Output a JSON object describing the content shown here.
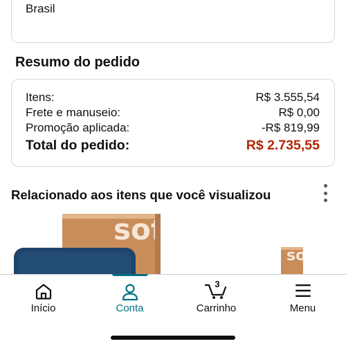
{
  "address": {
    "country": "Brasil"
  },
  "summary": {
    "heading": "Resumo do pedido",
    "rows": [
      {
        "label": "Itens:",
        "value": "R$ 3.555,54"
      },
      {
        "label": "Frete e manuseio:",
        "value": "R$ 0,00"
      },
      {
        "label": "Promoção aplicada:",
        "value": "-R$ 819,99"
      }
    ],
    "total": {
      "label": "Total do pedido:",
      "value": "R$ 2.735,55"
    }
  },
  "related": {
    "heading": "Relacionado aos itens que você visualizou",
    "more_icon": "kebab-menu-icon",
    "products": [
      {
        "brand_mark": "sofá",
        "icon": "product-box-image"
      },
      {
        "brand_mark": "sofá",
        "icon": "product-box-image"
      }
    ]
  },
  "nav": {
    "items": [
      {
        "label": "Início",
        "icon": "home-icon",
        "active": false
      },
      {
        "label": "Conta",
        "icon": "account-icon",
        "active": true
      },
      {
        "label": "Carrinho",
        "icon": "cart-icon",
        "badge": "3",
        "active": false
      },
      {
        "label": "Menu",
        "icon": "hamburger-menu-icon",
        "active": false
      }
    ]
  },
  "colors": {
    "accent": "#007185",
    "total_price": "#b12704",
    "text": "#0f1111",
    "border": "#d5d9d9"
  }
}
